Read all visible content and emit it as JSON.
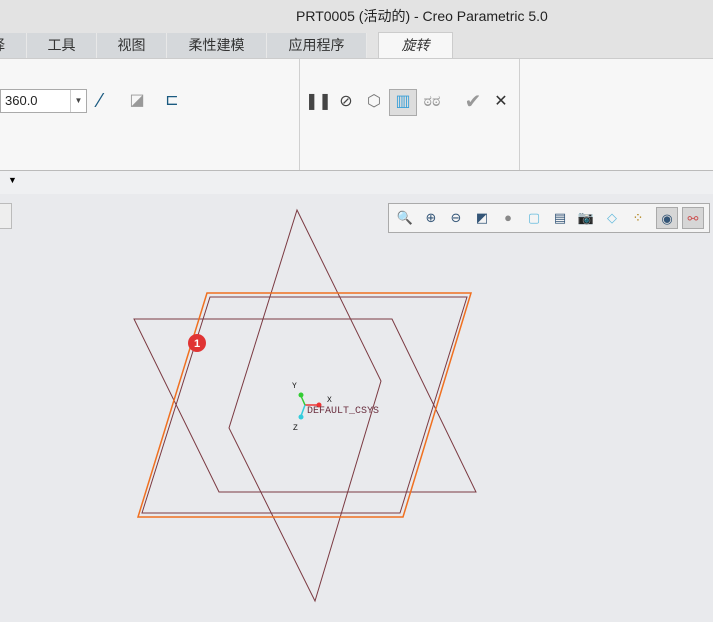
{
  "window": {
    "title": "PRT0005 (活动的) - Creo Parametric 5.0"
  },
  "tabs": [
    {
      "label": "择"
    },
    {
      "label": "工具"
    },
    {
      "label": "视图"
    },
    {
      "label": "柔性建模"
    },
    {
      "label": "应用程序"
    },
    {
      "label": "旋转",
      "active": true
    }
  ],
  "ribbon": {
    "angle_value": "360.0"
  },
  "canvas": {
    "csys_label": "DEFAULT_CSYS",
    "axis_x": "X",
    "axis_y": "Y",
    "axis_z": "Z",
    "badge": "1"
  },
  "colors": {
    "datum_plane": "#7b3a42",
    "selected": "#f07020",
    "badge": "#e03434"
  }
}
